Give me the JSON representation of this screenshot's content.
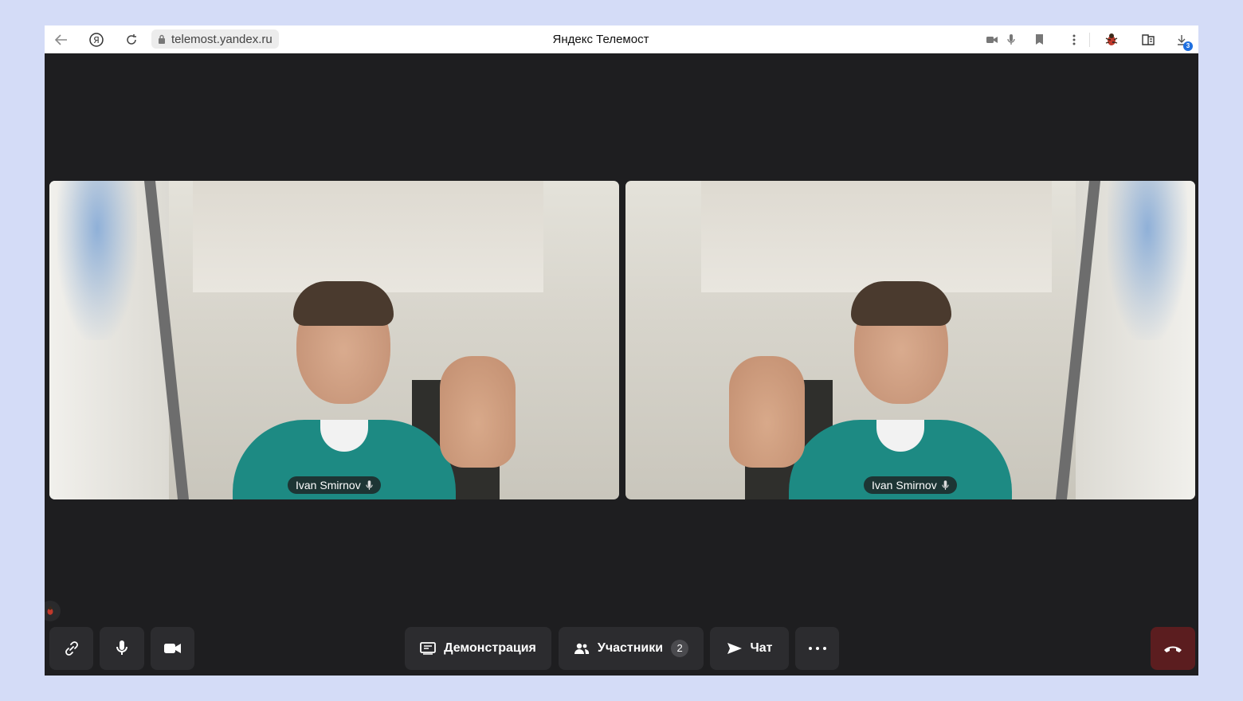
{
  "browser": {
    "url": "telemost.yandex.ru",
    "page_title": "Яндекс Телемост",
    "downloads_badge": "3",
    "icons": [
      "back-arrow-icon",
      "yandex-logo-icon",
      "reload-icon",
      "lock-icon",
      "camera-icon",
      "microphone-icon",
      "bookmark-icon",
      "kebab-menu-icon",
      "bug-extension-icon",
      "reader-icon",
      "downloads-icon"
    ]
  },
  "participants": [
    {
      "name": "Ivan Smirnov",
      "mic_icon": "microphone-icon"
    },
    {
      "name": "Ivan Smirnov",
      "mic_icon": "microphone-icon"
    }
  ],
  "controls": {
    "link_icon": "link-icon",
    "mic_icon": "microphone-icon",
    "camera_icon": "camera-icon",
    "screen_share_label": "Демонстрация",
    "participants_label": "Участники",
    "participants_count": "2",
    "chat_label": "Чат",
    "more_icon": "more-dots-icon",
    "end_call_icon": "hangup-icon",
    "end_call_color": "#5b1d1f"
  }
}
